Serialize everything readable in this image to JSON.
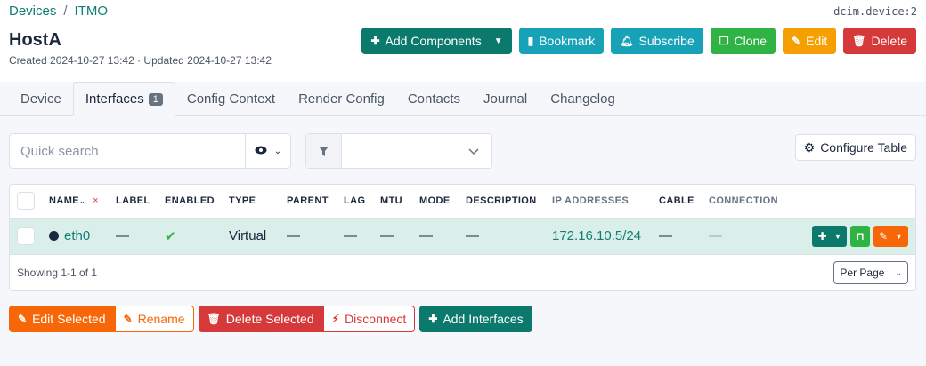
{
  "breadcrumb": {
    "devices": "Devices",
    "separator": "/",
    "site": "ITMO"
  },
  "object_ref": "dcim.device:2",
  "title": "HostA",
  "meta": "Created 2024-10-27 13:42 · Updated 2024-10-27 13:42",
  "actions": {
    "add_components": "Add Components",
    "bookmark": "Bookmark",
    "subscribe": "Subscribe",
    "clone": "Clone",
    "edit": "Edit",
    "delete": "Delete"
  },
  "tabs": [
    {
      "label": "Device"
    },
    {
      "label": "Interfaces",
      "badge": "1"
    },
    {
      "label": "Config Context"
    },
    {
      "label": "Render Config"
    },
    {
      "label": "Contacts"
    },
    {
      "label": "Journal"
    },
    {
      "label": "Changelog"
    }
  ],
  "search": {
    "placeholder": "Quick search",
    "value": ""
  },
  "configure_table": "Configure Table",
  "table": {
    "columns": [
      "NAME",
      "LABEL",
      "ENABLED",
      "TYPE",
      "PARENT",
      "LAG",
      "MTU",
      "MODE",
      "DESCRIPTION",
      "IP ADDRESSES",
      "CABLE",
      "CONNECTION"
    ],
    "sort_clear": "×",
    "rows": [
      {
        "name": "eth0",
        "label": "—",
        "enabled": "✔",
        "type": "Virtual",
        "parent": "—",
        "lag": "—",
        "mtu": "—",
        "mode": "—",
        "description": "—",
        "ip_addresses": "172.16.10.5/24",
        "cable": "—",
        "connection": "—"
      }
    ],
    "footer": "Showing 1-1 of 1",
    "per_page": "Per Page"
  },
  "bulk": {
    "edit_selected": "Edit Selected",
    "rename": "Rename",
    "delete_selected": "Delete Selected",
    "disconnect": "Disconnect",
    "add_interfaces": "Add Interfaces"
  },
  "colors": {
    "primary": "#0d8a7c",
    "link": "#0f7d73",
    "danger": "#d63939",
    "warning": "#f59f00",
    "success": "#2fb344",
    "info": "#17a2b8"
  }
}
